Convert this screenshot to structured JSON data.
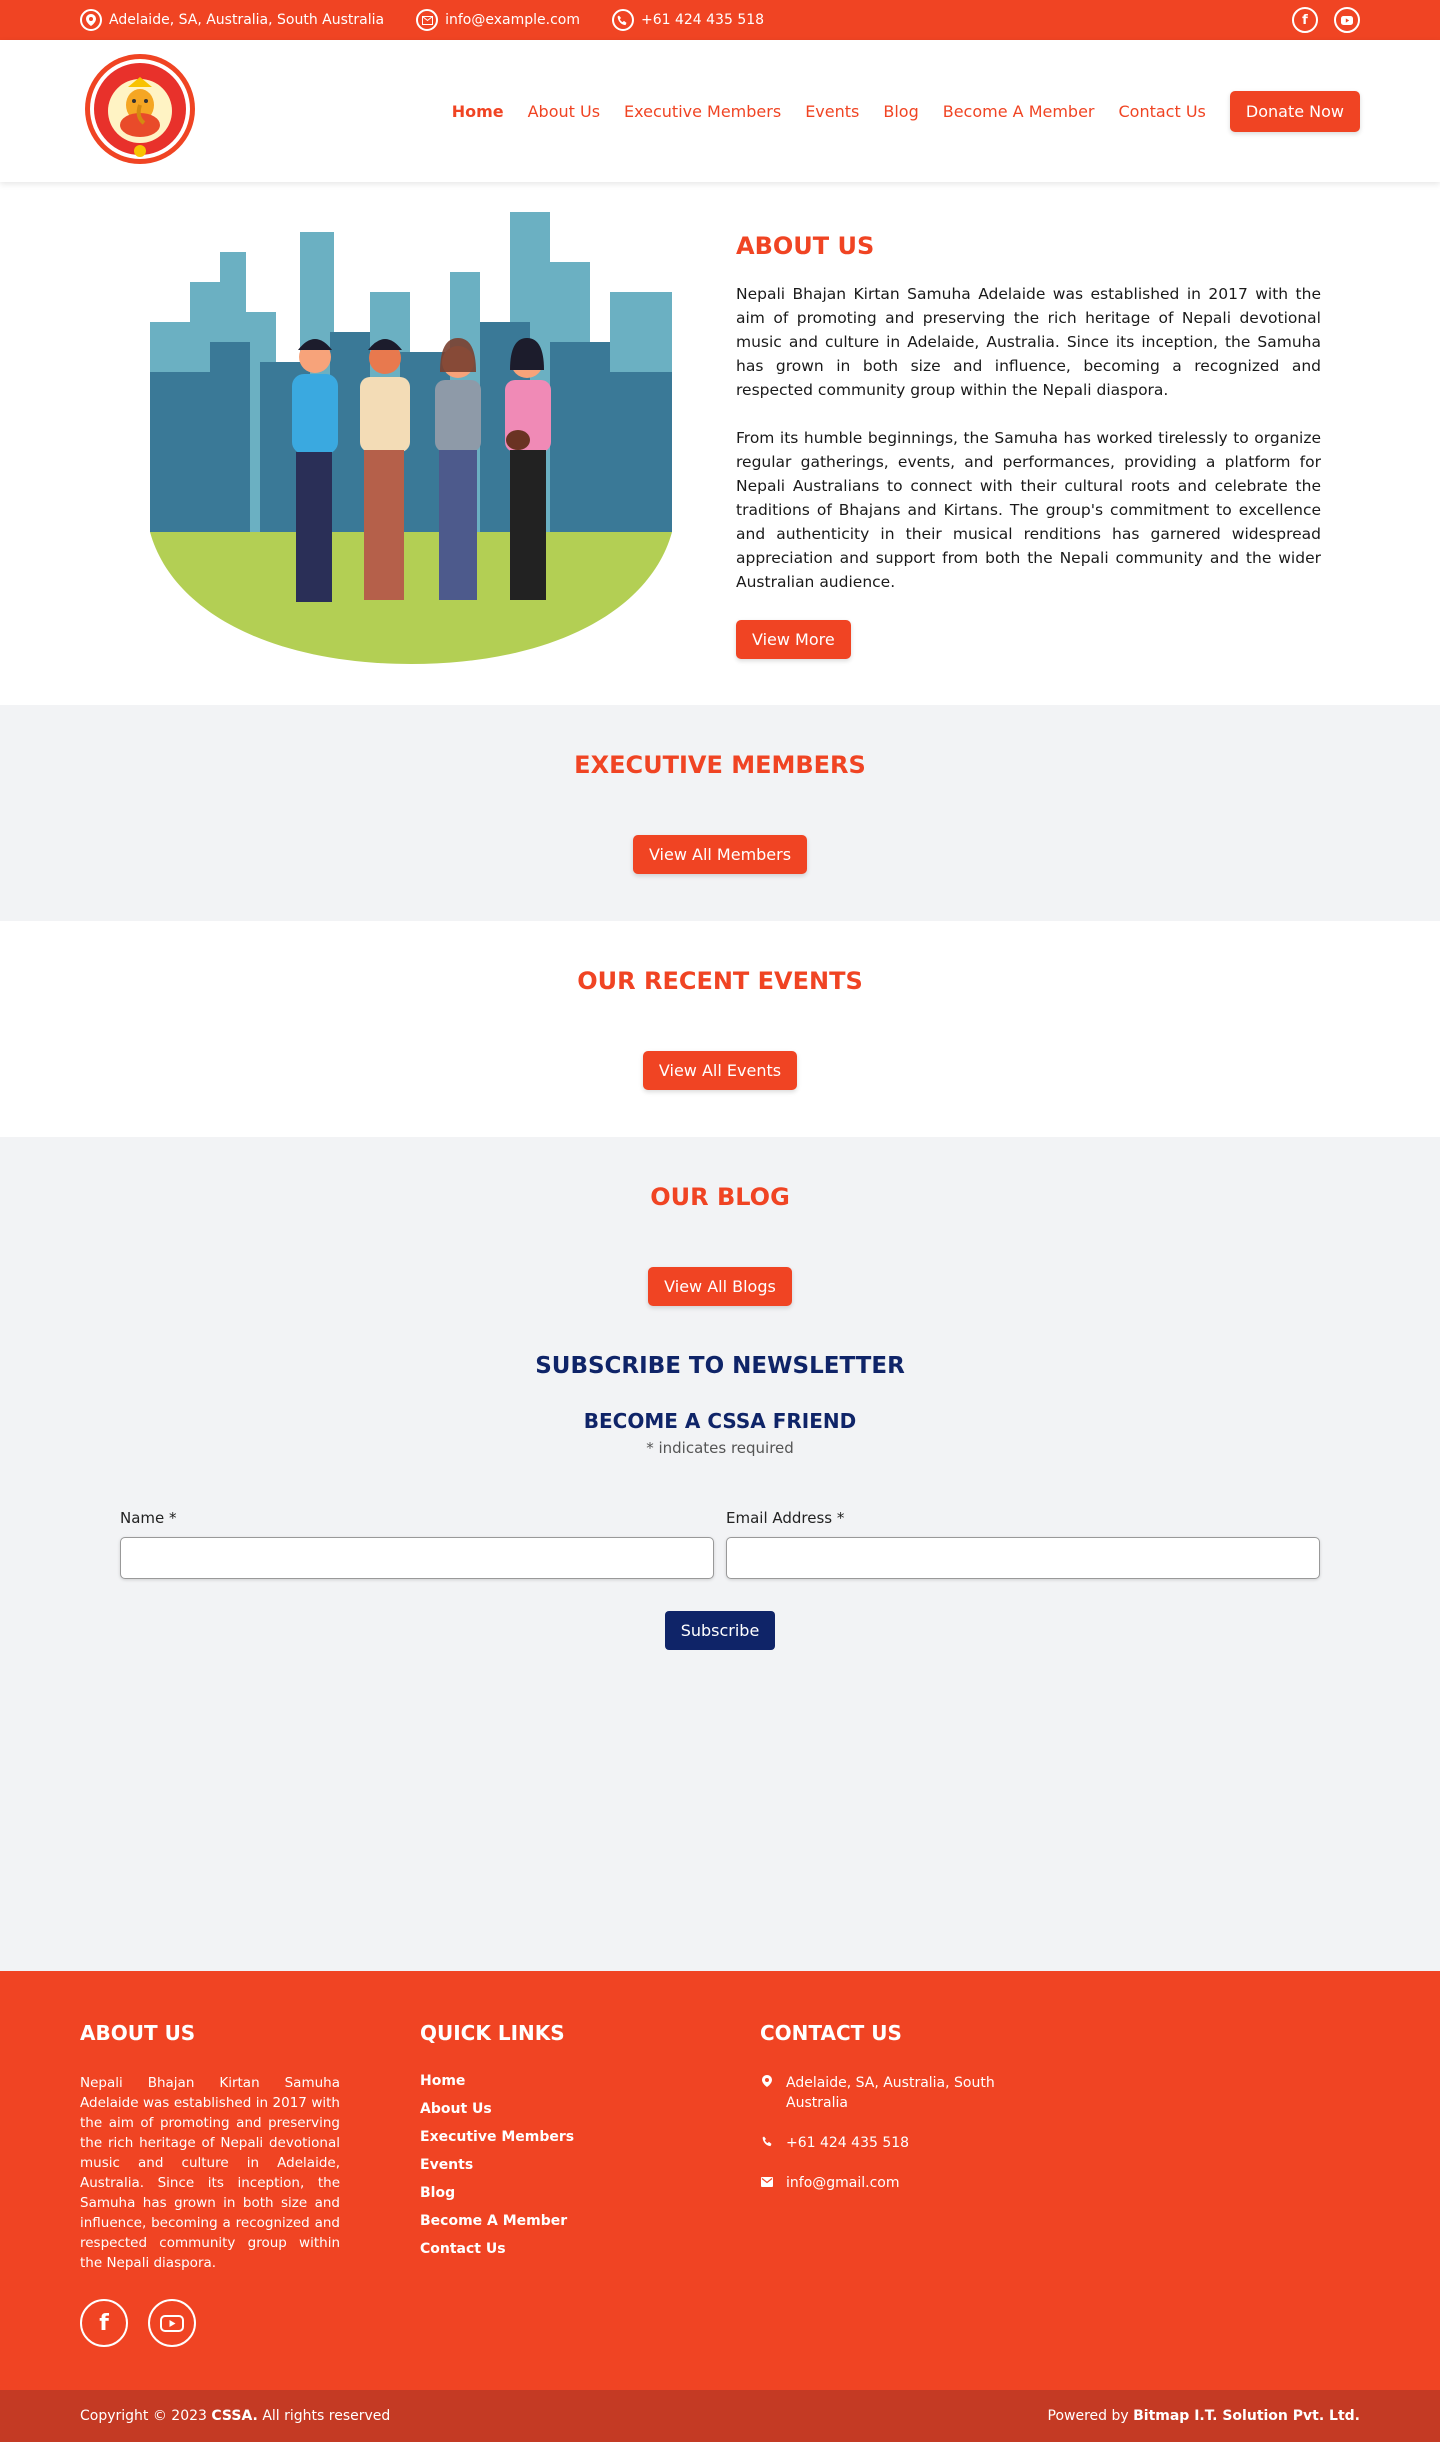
{
  "topbar": {
    "address": "Adelaide, SA, Australia, South Australia",
    "email": "info@example.com",
    "phone": "+61 424 435 518",
    "socials": [
      "facebook-icon",
      "youtube-icon"
    ]
  },
  "nav": {
    "items": [
      "Home",
      "About Us",
      "Executive Members",
      "Events",
      "Blog",
      "Become A Member",
      "Contact Us"
    ],
    "donate": "Donate Now"
  },
  "about": {
    "title": "ABOUT US",
    "p1": "Nepali Bhajan Kirtan Samuha Adelaide was established in 2017 with the aim of promoting and preserving the rich heritage of Nepali devotional music and culture in Adelaide, Australia. Since its inception, the Samuha has grown in both size and influence, becoming a recognized and respected community group within the Nepali diaspora.",
    "p2": "From its humble beginnings, the Samuha has worked tirelessly to organize regular gatherings, events, and performances, providing a platform for Nepali Australians to connect with their cultural roots and celebrate the traditions of Bhajans and Kirtans. The group's commitment to excellence and authenticity in their musical renditions has garnered widespread appreciation and support from both the Nepali community and the wider Australian audience.",
    "button": "View More"
  },
  "sections": {
    "members": {
      "title": "EXECUTIVE MEMBERS",
      "button": "View All Members"
    },
    "events": {
      "title": "OUR RECENT EVENTS",
      "button": "View All Events"
    },
    "blog": {
      "title": "OUR BLOG",
      "button": "View All Blogs"
    }
  },
  "newsletter": {
    "title": "SUBSCRIBE TO NEWSLETTER",
    "subtitle": "BECOME A CSSA FRIEND",
    "required_note": "* indicates required",
    "name_label": "Name *",
    "email_label": "Email Address *",
    "button": "Subscribe"
  },
  "footer": {
    "about_title": "ABOUT US",
    "about_text": "Nepali Bhajan Kirtan Samuha Adelaide was established in 2017 with the aim of promoting and preserving the rich heritage of Nepali devotional music and culture in Adelaide, Australia. Since its inception, the Samuha has grown in both size and influence, becoming a recognized and respected community group within the Nepali diaspora.",
    "links_title": "QUICK LINKS",
    "links": [
      "Home",
      "About Us",
      "Executive Members",
      "Events",
      "Blog",
      "Become A Member",
      "Contact Us"
    ],
    "contact_title": "CONTACT US",
    "contact_address": "Adelaide, SA, Australia, South Australia",
    "contact_phone": "+61 424 435 518",
    "contact_email": "info@gmail.com"
  },
  "bottombar": {
    "copyright_pre": "Copyright © 2023 ",
    "copyright_brand": "CSSA.",
    "copyright_post": " All rights reserved",
    "powered_pre": "Powered by ",
    "powered_brand": "Bitmap I.T. Solution Pvt. Ltd."
  },
  "colors": {
    "brand": "#f04423",
    "navy": "#0f2468",
    "footer_bottom": "#c43a24",
    "section_grey": "#f2f3f5"
  }
}
